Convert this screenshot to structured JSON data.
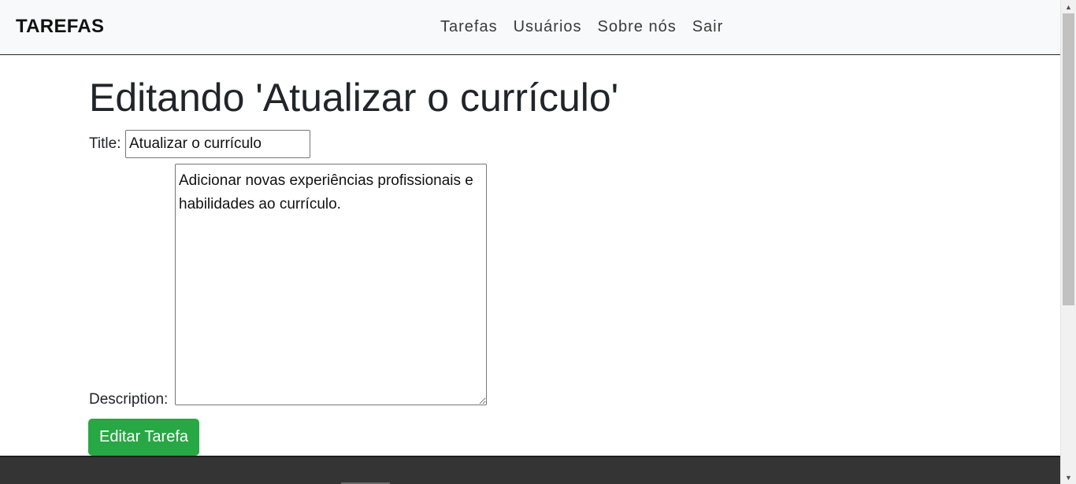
{
  "navbar": {
    "brand": "TAREFAS",
    "links": [
      {
        "label": "Tarefas"
      },
      {
        "label": "Usuários"
      },
      {
        "label": "Sobre nós"
      },
      {
        "label": "Sair"
      }
    ]
  },
  "main": {
    "title": "Editando 'Atualizar o currículo'",
    "form": {
      "title_label": "Title:",
      "title_value": "Atualizar o currículo",
      "description_label": "Description:",
      "description_value": "Adicionar novas experiências profissionais e habilidades ao currículo.",
      "submit_label": "Editar Tarefa"
    }
  },
  "scrollbar": {
    "up_icon": "arrow-up-icon",
    "down_icon": "arrow-down-icon"
  },
  "colors": {
    "navbar_bg": "#f8f9fa",
    "submit_bg": "#28a745",
    "footer_bg": "#343434"
  }
}
